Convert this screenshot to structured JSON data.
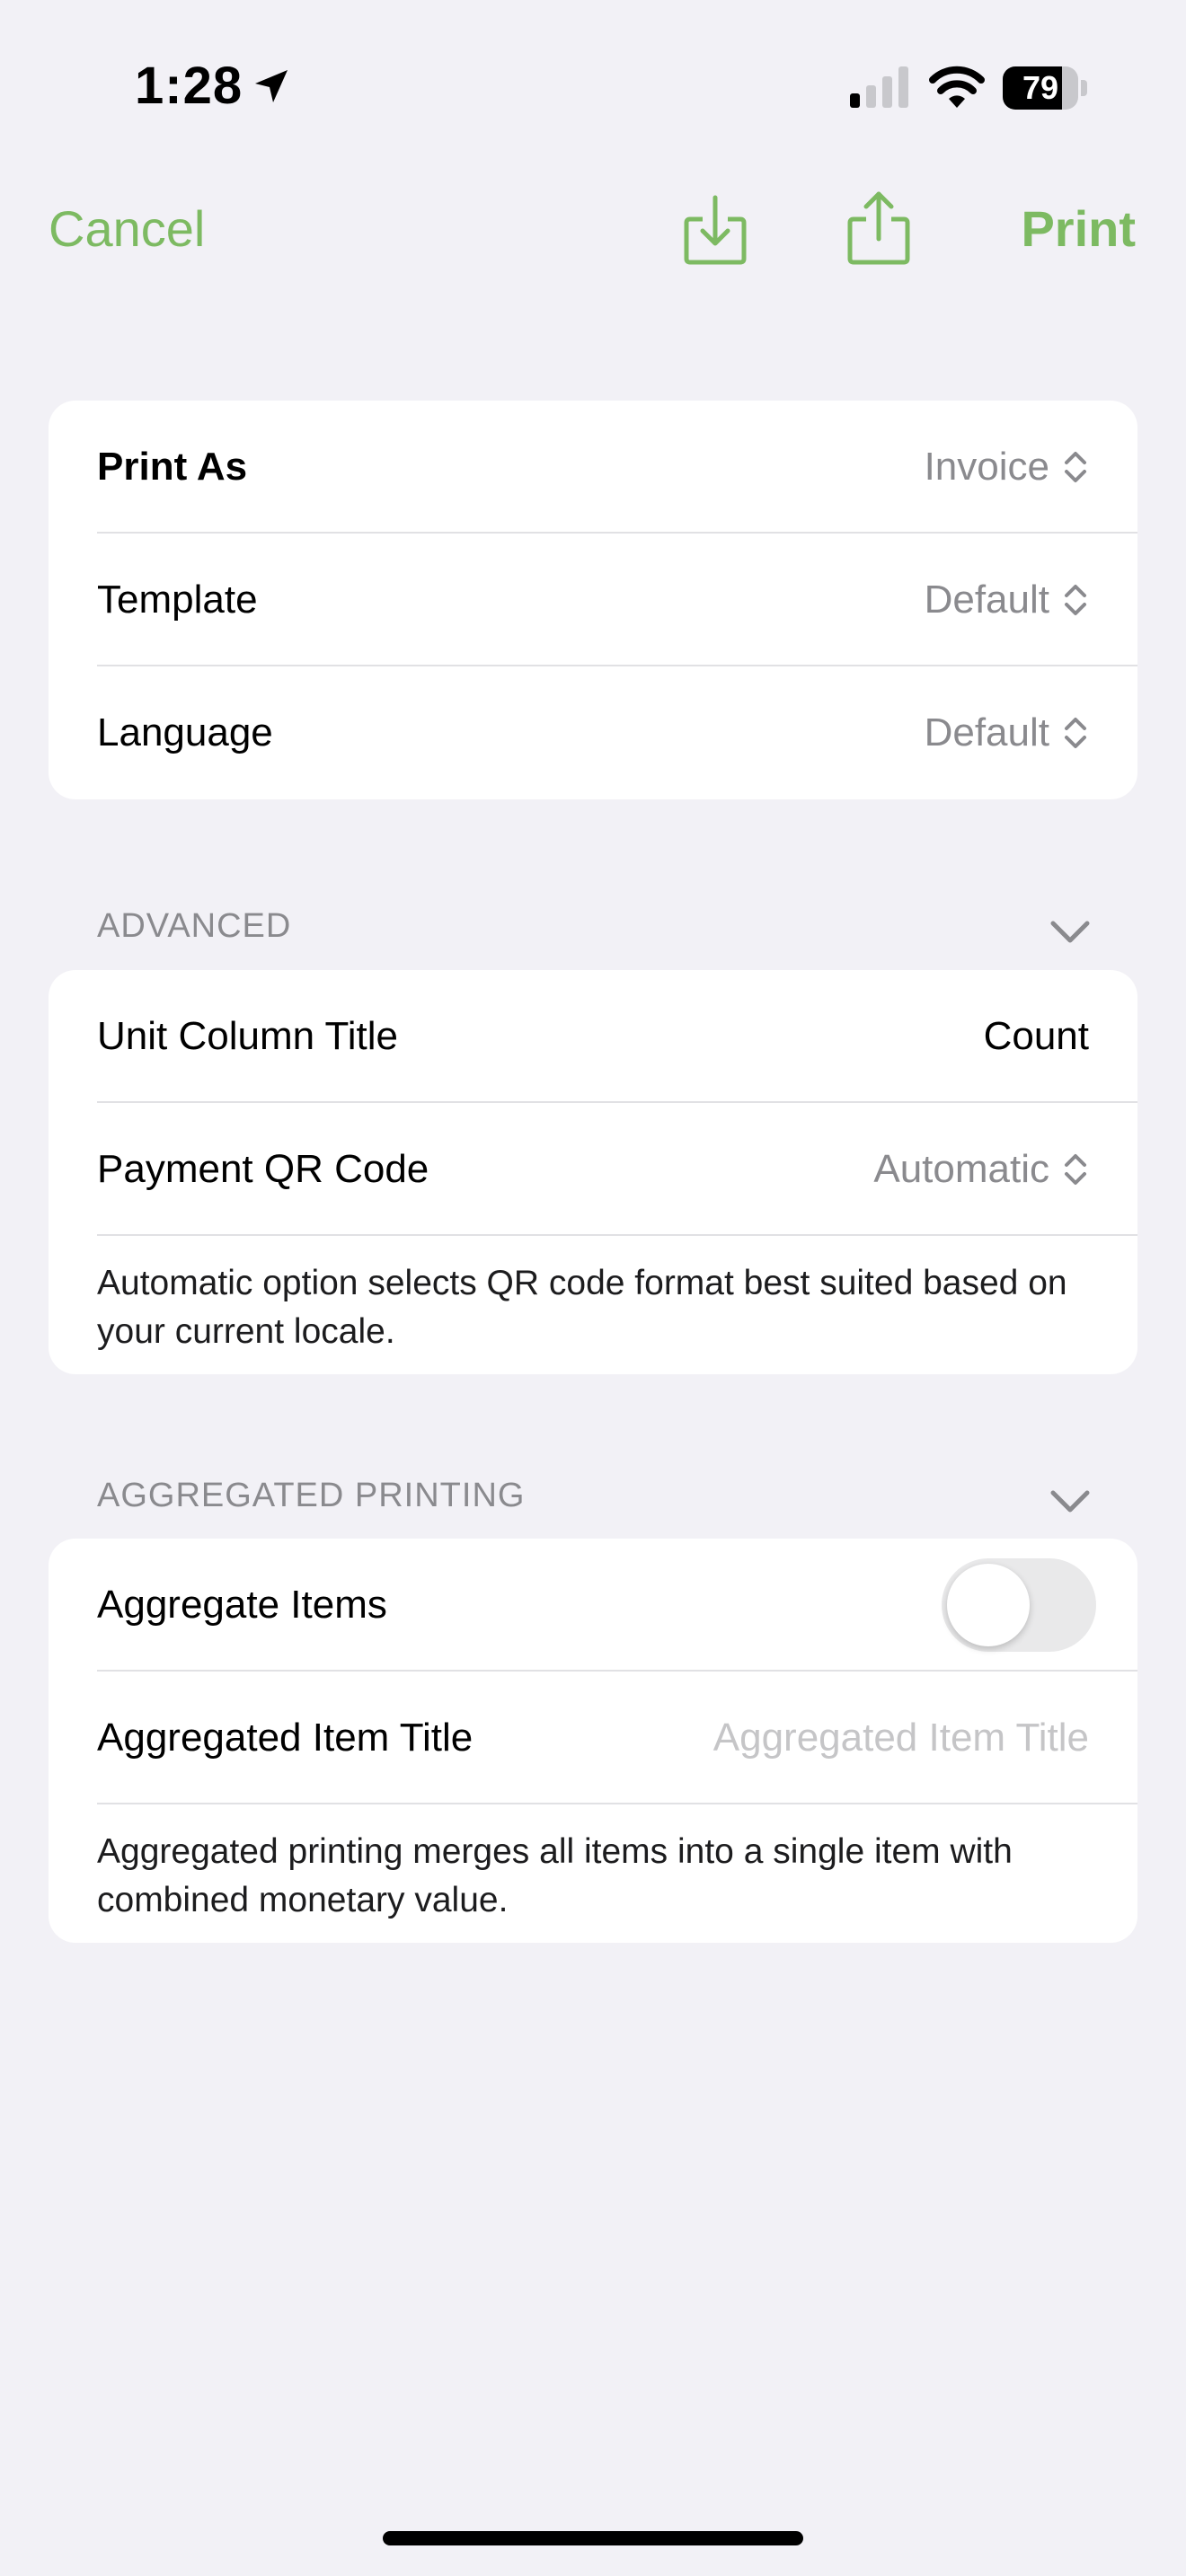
{
  "status_bar": {
    "time": "1:28",
    "battery": "79",
    "battery_level": 0.79,
    "icons": [
      "location-arrow-icon",
      "cellular-signal-icon",
      "wifi-icon",
      "battery-icon"
    ]
  },
  "nav": {
    "cancel_label": "Cancel",
    "print_label": "Print",
    "icons": [
      "download-icon",
      "share-icon"
    ],
    "accent_color": "#7dba62"
  },
  "print_settings": {
    "rows": [
      {
        "label": "Print As",
        "value": "Invoice"
      },
      {
        "label": "Template",
        "value": "Default"
      },
      {
        "label": "Language",
        "value": "Default"
      }
    ]
  },
  "advanced": {
    "header": "ADVANCED",
    "unit_column": {
      "label": "Unit Column Title",
      "value": "Count"
    },
    "payment_qr": {
      "label": "Payment QR Code",
      "value": "Automatic"
    },
    "footnote": "Automatic option selects QR code format best suited based on your current locale."
  },
  "aggregated": {
    "header": "AGGREGATED PRINTING",
    "aggregate_items": {
      "label": "Aggregate Items",
      "enabled": false
    },
    "item_title": {
      "label": "Aggregated Item Title",
      "placeholder": "Aggregated Item Title",
      "value": ""
    },
    "footnote": "Aggregated printing merges all items into a single item with combined monetary value."
  }
}
